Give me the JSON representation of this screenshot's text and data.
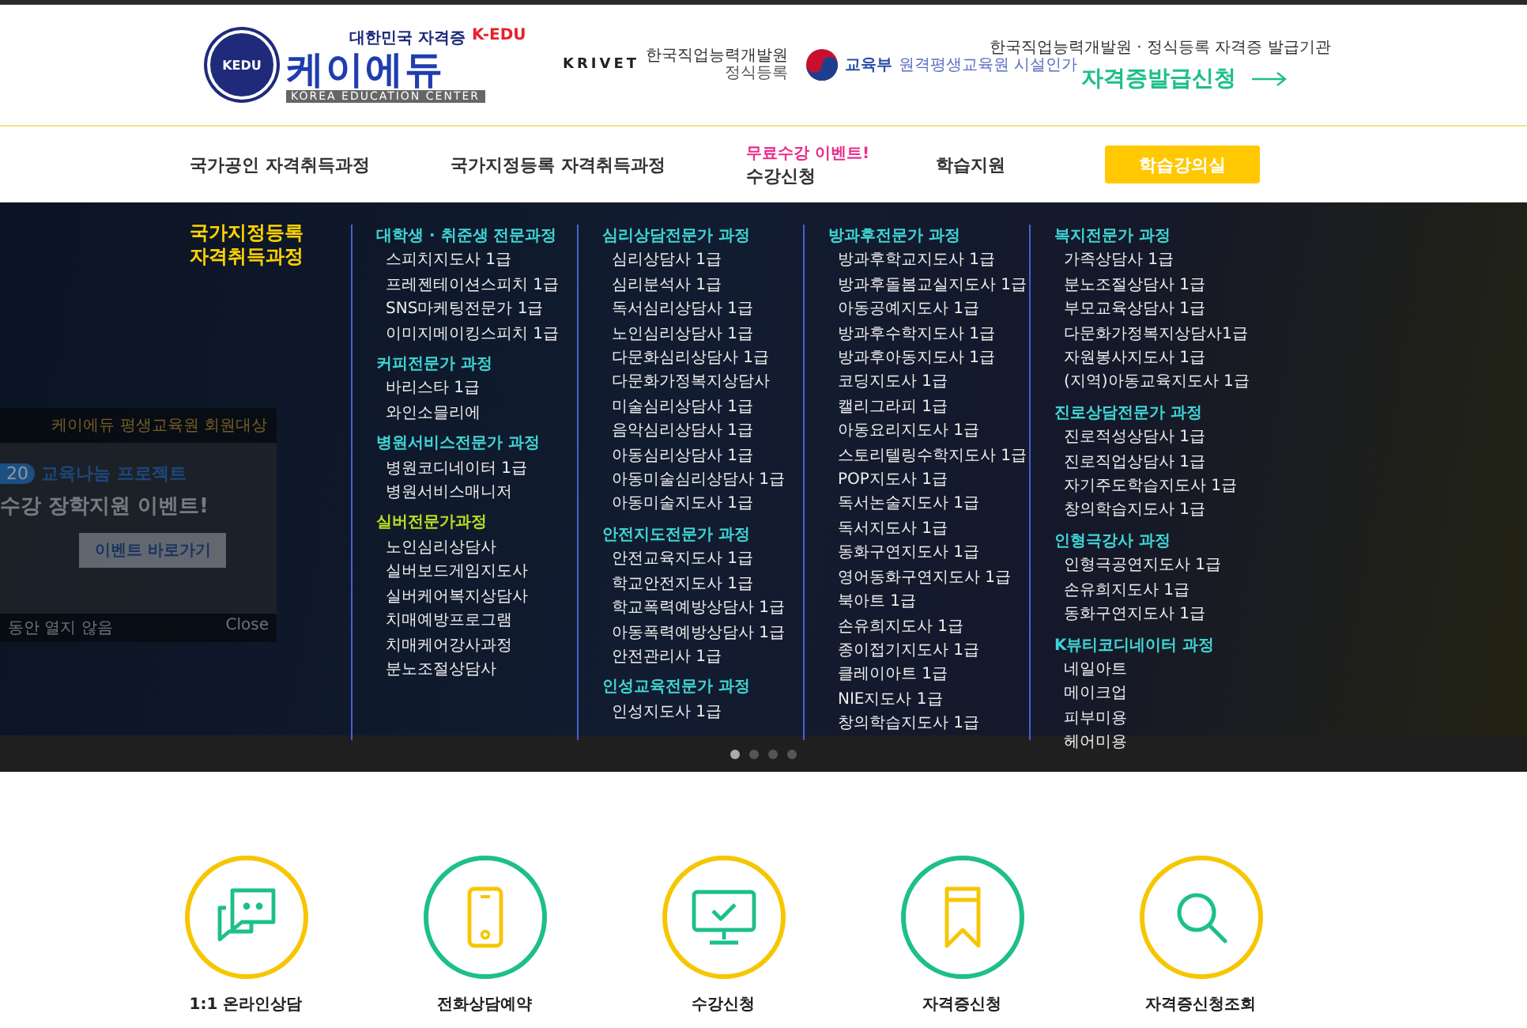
{
  "header": {
    "logo": {
      "badge": "KEDU",
      "tagline": "대한민국 자격증",
      "tagline_en": "K-EDU",
      "name": "케이에듀",
      "subtitle": "KOREA EDUCATION CENTER"
    },
    "partners": [
      {
        "kind": "krivet",
        "name": "KRIVET",
        "text": "한국직업능력개발원",
        "sub": "정식등록"
      },
      {
        "kind": "ministry",
        "name": "교육부",
        "text": "원격평생교육원 시설인가"
      }
    ],
    "cta": {
      "caption": "한국직업능력개발원 · 정식등록 자격증 발급기관",
      "label": "자격증발급신청"
    }
  },
  "nav": [
    {
      "kind": "link",
      "label": "국가공인 자격취득과정"
    },
    {
      "kind": "link",
      "label": "국가지정등록 자격취득과정"
    },
    {
      "kind": "link",
      "label": "수강신청",
      "badge": "무료수강 이벤트!"
    },
    {
      "kind": "link",
      "label": "학습지원"
    },
    {
      "kind": "button",
      "label": "학습강의실"
    }
  ],
  "mega_menu": {
    "title": [
      "국가지정등록",
      "자격취득과정"
    ],
    "columns": [
      {
        "groups": [
          {
            "title": "대학생 · 취준생 전문과정",
            "color": "#3fd3d3",
            "items": [
              "스피치지도사 1급",
              "프레젠테이션스피치 1급",
              "SNS마케팅전문가 1급",
              "이미지메이킹스피치 1급"
            ]
          },
          {
            "title": "커피전문가 과정",
            "color": "#3fd3d3",
            "items": [
              "바리스타 1급",
              "와인소믈리에"
            ]
          },
          {
            "title": "병원서비스전문가 과정",
            "color": "#3fd3d3",
            "items": [
              "병원코디네이터 1급",
              "병원서비스매니저"
            ]
          },
          {
            "title": "실버전문가과정",
            "color": "#b8dc22",
            "items": [
              "노인심리상담사",
              "실버보드게임지도사",
              "실버케어복지상담사",
              "치매예방프로그램",
              "치매케어강사과정",
              "분노조절상담사"
            ]
          }
        ]
      },
      {
        "groups": [
          {
            "title": "심리상담전문가 과정",
            "color": "#3fd3d3",
            "items": [
              "심리상담사 1급",
              "심리분석사 1급",
              "독서심리상담사 1급",
              "노인심리상담사 1급",
              "다문화심리상담사 1급",
              "다문화가정복지상담사",
              "미술심리상담사 1급",
              "음악심리상담사 1급",
              "아동심리상담사 1급",
              "아동미술심리상담사 1급",
              "아동미술지도사 1급"
            ]
          },
          {
            "title": "안전지도전문가 과정",
            "color": "#3fd3d3",
            "items": [
              "안전교육지도사 1급",
              "학교안전지도사 1급",
              "학교폭력예방상담사 1급",
              "아동폭력예방상담사 1급",
              "안전관리사 1급"
            ]
          },
          {
            "title": "인성교육전문가 과정",
            "color": "#3fd3d3",
            "items": [
              "인성지도사 1급"
            ]
          }
        ]
      },
      {
        "groups": [
          {
            "title": "방과후전문가 과정",
            "color": "#3fd3d3",
            "items": [
              "방과후학교지도사 1급",
              "방과후돌봄교실지도사 1급",
              "아동공예지도사 1급",
              "방과후수학지도사 1급",
              "방과후아동지도사 1급",
              "코딩지도사 1급",
              "캘리그라피 1급",
              "아동요리지도사 1급",
              "스토리텔링수학지도사 1급",
              "POP지도사 1급",
              "독서논술지도사 1급",
              "독서지도사 1급",
              "동화구연지도사 1급",
              "영어동화구연지도사 1급",
              "북아트 1급",
              "손유희지도사 1급",
              "종이접기지도사 1급",
              "클레이아트 1급",
              "NIE지도사 1급",
              "창의학습지도사 1급"
            ]
          }
        ]
      },
      {
        "groups": [
          {
            "title": "복지전문가 과정",
            "color": "#3fd3d3",
            "items": [
              "가족상담사 1급",
              "분노조절상담사 1급",
              "부모교육상담사 1급",
              "다문화가정복지상담사1급",
              "자원봉사지도사 1급",
              "(지역)아동교육지도사 1급"
            ]
          },
          {
            "title": "진로상담전문가 과정",
            "color": "#3fd3d3",
            "items": [
              "진로적성상담사 1급",
              "진로직업상담사 1급",
              "자기주도학습지도사 1급",
              "창의학습지도사 1급"
            ]
          },
          {
            "title": "인형극강사 과정",
            "color": "#3fd3d3",
            "items": [
              "인형극공연지도사 1급",
              "손유희지도사 1급",
              "동화구연지도사 1급"
            ]
          },
          {
            "title": "K뷰티코디네이터 과정",
            "color": "#3fd3d3",
            "items": [
              "네일아트",
              "메이크업",
              "피부미용",
              "헤어미용"
            ]
          }
        ]
      }
    ]
  },
  "popup": {
    "heading": "케이에듀 평생교육원 회원대상",
    "badge": "20",
    "line1": "교육나눔 프로젝트",
    "line2": "수강 장학지원 이벤트!",
    "button": "이벤트 바로가기",
    "dismiss": "동안 열지 않음",
    "close": "Close"
  },
  "slider_dots": [
    {
      "selected": true
    },
    {
      "selected": false
    },
    {
      "selected": false
    },
    {
      "selected": false
    }
  ],
  "quick_links": [
    {
      "kind": "chat",
      "label": "1:1 온라인상담",
      "color": "#f7c600"
    },
    {
      "kind": "phone",
      "label": "전화상담예약",
      "color": "#1dbf8c"
    },
    {
      "kind": "monitor",
      "label": "수강신청",
      "color": "#f7c600"
    },
    {
      "kind": "bookmark",
      "label": "자격증신청",
      "color": "#1dbf8c"
    },
    {
      "kind": "search",
      "label": "자격증신청조회",
      "color": "#f7c600"
    }
  ]
}
